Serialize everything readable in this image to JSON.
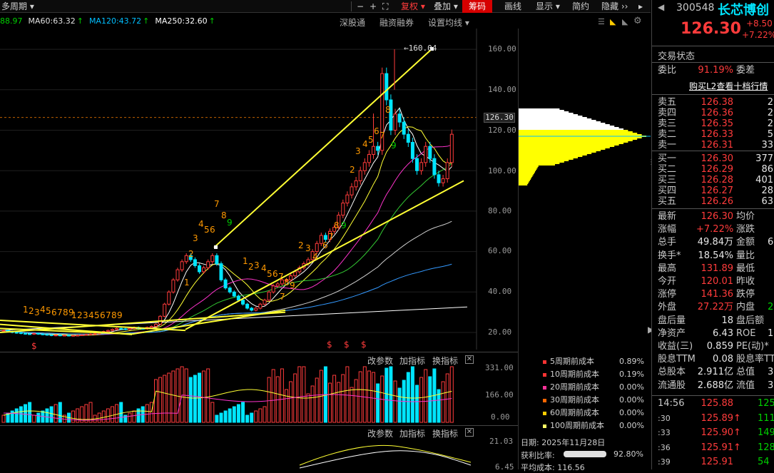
{
  "toolbar": {
    "period": "多周期",
    "restore": "复权",
    "overlay": "叠加",
    "chips": "筹码",
    "draw": "画线",
    "display": "显示",
    "simple": "简约",
    "hide": "隐藏"
  },
  "ma_legend": [
    {
      "text": "88.97",
      "color": "#00d000"
    },
    {
      "text": "MA60:63.32",
      "color": "#e0e0e0"
    },
    {
      "text": "MA120:43.72",
      "color": "#00bfff"
    },
    {
      "text": "MA250:32.60",
      "color": "#ffffff"
    }
  ],
  "chart_menu": {
    "deep": "深股通",
    "margin": "融资融券",
    "ma_settings": "设置均线"
  },
  "price_axis": [
    "160.00",
    "140.00",
    "126.30",
    "120.00",
    "100.00",
    "80.00",
    "60.00",
    "40.00",
    "20.00"
  ],
  "peak_label": "160.04",
  "vol_axis": [
    "331.00",
    "166.00",
    "0.00"
  ],
  "ind_axis": [
    "21.03",
    "6.45"
  ],
  "panel_buttons": {
    "params": "改参数",
    "add_ind": "加指标",
    "switch_ind": "换指标",
    "close": "✕"
  },
  "signals": [
    "$",
    "$",
    "$",
    "$"
  ],
  "cost_list": [
    {
      "name": "5周期前成本",
      "pct": "0.89%",
      "color": "#ff3333"
    },
    {
      "name": "10周期前成本",
      "pct": "0.19%",
      "color": "#ff3333"
    },
    {
      "name": "20周期前成本",
      "pct": "0.00%",
      "color": "#ff3399"
    },
    {
      "name": "30周期前成本",
      "pct": "0.00%",
      "color": "#ff6600"
    },
    {
      "name": "60周期前成本",
      "pct": "0.00%",
      "color": "#ffcc00"
    },
    {
      "name": "100周期前成本",
      "pct": "0.00%",
      "color": "#ffff66"
    }
  ],
  "chip_info": {
    "date": "日期: 2025年11月28日",
    "profit_label": "获利比率:",
    "profit_pct": "92.80%",
    "avg_cost": "平均成本: 116.56"
  },
  "stock": {
    "code": "300548",
    "name": "长芯博创",
    "price": "126.30",
    "change": "+8.50",
    "change_pct": "+7.22%",
    "status_title": "交易状态",
    "weibi_label": "委比",
    "weibi": "91.19%",
    "weicha_label": "委差",
    "l2_link": "购买L2查看十档行情"
  },
  "asks": [
    {
      "label": "卖五",
      "price": "126.38",
      "vol": "2"
    },
    {
      "label": "卖四",
      "price": "126.36",
      "vol": "2"
    },
    {
      "label": "卖三",
      "price": "126.35",
      "vol": "2"
    },
    {
      "label": "卖二",
      "price": "126.33",
      "vol": "5"
    },
    {
      "label": "卖一",
      "price": "126.31",
      "vol": "33"
    }
  ],
  "bids": [
    {
      "label": "买一",
      "price": "126.30",
      "vol": "377"
    },
    {
      "label": "买二",
      "price": "126.29",
      "vol": "86"
    },
    {
      "label": "买三",
      "price": "126.28",
      "vol": "401"
    },
    {
      "label": "买四",
      "price": "126.27",
      "vol": "28"
    },
    {
      "label": "买五",
      "price": "126.26",
      "vol": "63"
    }
  ],
  "quote": [
    {
      "l": "最新",
      "v": "126.30",
      "c": "red",
      "l2": "均价"
    },
    {
      "l": "涨幅",
      "v": "+7.22%",
      "c": "red",
      "l2": "涨跌"
    },
    {
      "l": "总手",
      "v": "49.84万",
      "c": "white",
      "l2": "金额",
      "v2": "6"
    },
    {
      "l": "换手*",
      "v": "18.54%",
      "c": "white",
      "l2": "量比"
    },
    {
      "l": "最高",
      "v": "131.89",
      "c": "red",
      "l2": "最低"
    },
    {
      "l": "今开",
      "v": "120.01",
      "c": "red",
      "l2": "昨收"
    },
    {
      "l": "涨停",
      "v": "141.36",
      "c": "red",
      "l2": "跌停"
    },
    {
      "l": "外盘",
      "v": "27.22万",
      "c": "red",
      "l2": "内盘",
      "v2": "2"
    },
    {
      "l": "盘后量",
      "v": "18",
      "c": "white",
      "l2": "盘后额"
    },
    {
      "l": "净资产",
      "v": "6.43",
      "c": "white",
      "l2": "ROE",
      "v2": "1"
    },
    {
      "l": "收益(三)",
      "v": "0.859",
      "c": "white",
      "l2": "PE(动)*"
    },
    {
      "l": "股息TTM",
      "v": "0.08",
      "c": "white",
      "l2": "股息率TTM"
    },
    {
      "l": "总股本",
      "v": "2.911亿",
      "c": "white",
      "l2": "总值",
      "v2": "3"
    },
    {
      "l": "流通股",
      "v": "2.688亿",
      "c": "white",
      "l2": "流值",
      "v2": "3"
    }
  ],
  "ticks": [
    {
      "t": "14:56",
      "p": "125.88",
      "v": "125",
      "arrow": ""
    },
    {
      "t": ":30",
      "p": "125.89",
      "v": "111",
      "arrow": "↑"
    },
    {
      "t": ":33",
      "p": "125.90",
      "v": "149",
      "arrow": "↑"
    },
    {
      "t": ":36",
      "p": "125.91",
      "v": "128",
      "arrow": "↑"
    },
    {
      "t": ":39",
      "p": "125.91",
      "v": "54",
      "arrow": ""
    }
  ]
}
